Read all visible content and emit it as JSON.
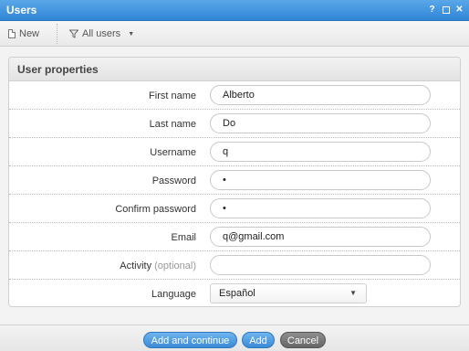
{
  "window": {
    "title": "Users",
    "help_icon": "?"
  },
  "toolbar": {
    "new_label": "New",
    "filter_label": "All users"
  },
  "panel": {
    "title": "User properties",
    "fields": [
      {
        "label": "First name",
        "value": "Alberto"
      },
      {
        "label": "Last name",
        "value": "Do"
      },
      {
        "label": "Username",
        "value": "q"
      },
      {
        "label": "Password",
        "value": "•"
      },
      {
        "label": "Confirm password",
        "value": "•"
      },
      {
        "label": "Email",
        "value": "q@gmail.com"
      },
      {
        "label": "Activity",
        "optional_note": "(optional)",
        "value": ""
      },
      {
        "label": "Language",
        "value": "Español"
      }
    ]
  },
  "footer": {
    "add_continue_label": "Add and continue",
    "add_label": "Add",
    "cancel_label": "Cancel"
  },
  "colors": {
    "titlebar": "#3b8fdc",
    "primary_button": "#4a97dd",
    "cancel_button": "#777777"
  }
}
